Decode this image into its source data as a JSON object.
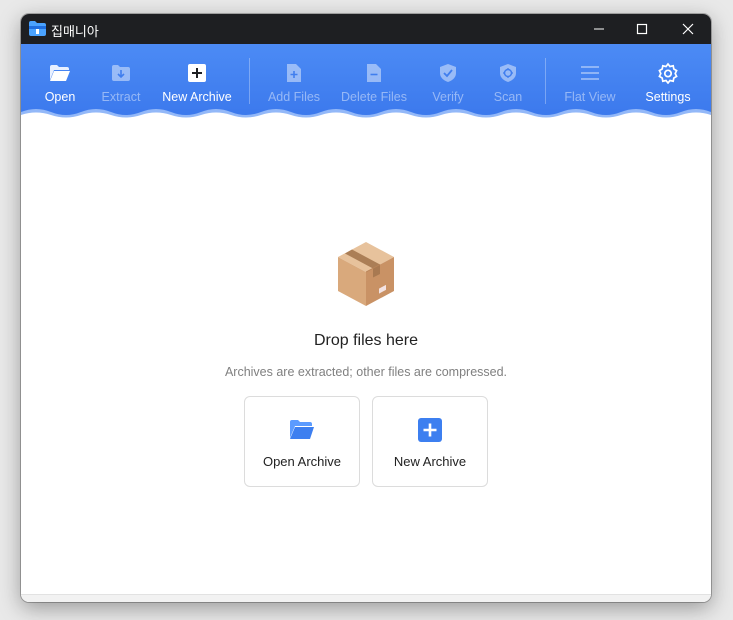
{
  "window": {
    "title": "집매니아",
    "controls": {
      "minimize": "minimize",
      "maximize": "maximize",
      "close": "close"
    }
  },
  "toolbar": {
    "items": [
      {
        "label": "Open",
        "icon": "folder-open-icon",
        "enabled": true
      },
      {
        "label": "Extract",
        "icon": "extract-icon",
        "enabled": false
      },
      {
        "label": "New Archive",
        "icon": "plus-square-icon",
        "enabled": true
      },
      {
        "label": "Add Files",
        "icon": "add-file-icon",
        "enabled": false
      },
      {
        "label": "Delete Files",
        "icon": "delete-file-icon",
        "enabled": false
      },
      {
        "label": "Verify",
        "icon": "shield-check-icon",
        "enabled": false
      },
      {
        "label": "Scan",
        "icon": "shield-scan-icon",
        "enabled": false
      },
      {
        "label": "Flat View",
        "icon": "list-icon",
        "enabled": false
      },
      {
        "label": "Settings",
        "icon": "gear-icon",
        "enabled": true
      }
    ]
  },
  "dropzone": {
    "title": "Drop files here",
    "subtitle": "Archives are extracted; other files are compressed.",
    "open_label": "Open Archive",
    "new_label": "New Archive"
  },
  "colors": {
    "accent": "#3b78ec",
    "titlebar": "#1e1f22",
    "icon_blue": "#3d7ff0"
  }
}
